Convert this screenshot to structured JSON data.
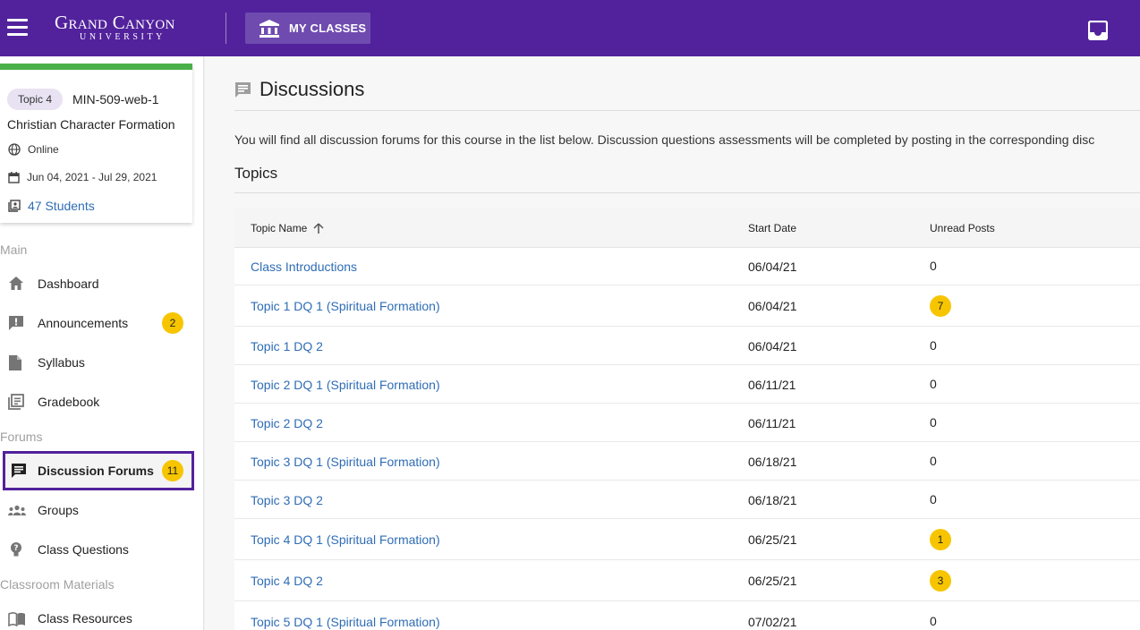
{
  "header": {
    "logo_name": "Grand Canyon",
    "logo_sub": "UNIVERSITY",
    "my_classes_label": "MY CLASSES"
  },
  "course": {
    "topic_pill": "Topic 4",
    "code": "MIN-509-web-1",
    "name": "Christian Character Formation",
    "modality": "Online",
    "dates": "Jun 04, 2021 - Jul 29, 2021",
    "students": "47 Students"
  },
  "sidebar": {
    "sections": [
      "Main",
      "Forums",
      "Classroom Materials"
    ],
    "items": [
      {
        "label": "Dashboard",
        "icon": "home-icon"
      },
      {
        "label": "Announcements",
        "icon": "announcement-icon",
        "badge": "2"
      },
      {
        "label": "Syllabus",
        "icon": "document-icon"
      },
      {
        "label": "Gradebook",
        "icon": "gradebook-icon"
      },
      {
        "label": "Discussion Forums",
        "icon": "forum-icon",
        "badge": "11"
      },
      {
        "label": "Groups",
        "icon": "groups-icon"
      },
      {
        "label": "Class Questions",
        "icon": "question-icon"
      },
      {
        "label": "Class Resources",
        "icon": "book-icon"
      }
    ]
  },
  "main": {
    "title": "Discussions",
    "intro": "You will find all discussion forums for this course in the list below. Discussion questions assessments will be completed by posting in the corresponding disc",
    "topics_heading": "Topics",
    "columns": {
      "name": "Topic Name",
      "start": "Start Date",
      "unread": "Unread Posts"
    },
    "rows": [
      {
        "name": "Class Introductions",
        "start": "06/04/21",
        "unread": "0"
      },
      {
        "name": "Topic 1 DQ 1 (Spiritual Formation)",
        "start": "06/04/21",
        "unread": "7"
      },
      {
        "name": "Topic 1 DQ 2",
        "start": "06/04/21",
        "unread": "0"
      },
      {
        "name": "Topic 2 DQ 1 (Spiritual Formation)",
        "start": "06/11/21",
        "unread": "0"
      },
      {
        "name": "Topic 2 DQ 2",
        "start": "06/11/21",
        "unread": "0"
      },
      {
        "name": "Topic 3 DQ 1 (Spiritual Formation)",
        "start": "06/18/21",
        "unread": "0"
      },
      {
        "name": "Topic 3 DQ 2",
        "start": "06/18/21",
        "unread": "0"
      },
      {
        "name": "Topic 4 DQ 1 (Spiritual Formation)",
        "start": "06/25/21",
        "unread": "1"
      },
      {
        "name": "Topic 4 DQ 2",
        "start": "06/25/21",
        "unread": "3"
      },
      {
        "name": "Topic 5 DQ 1 (Spiritual Formation)",
        "start": "07/02/21",
        "unread": "0"
      }
    ]
  },
  "colors": {
    "brand_purple": "#52229c",
    "badge_yellow": "#f7c500",
    "link_blue": "#2f6db5",
    "accent_green": "#4ab04a"
  }
}
